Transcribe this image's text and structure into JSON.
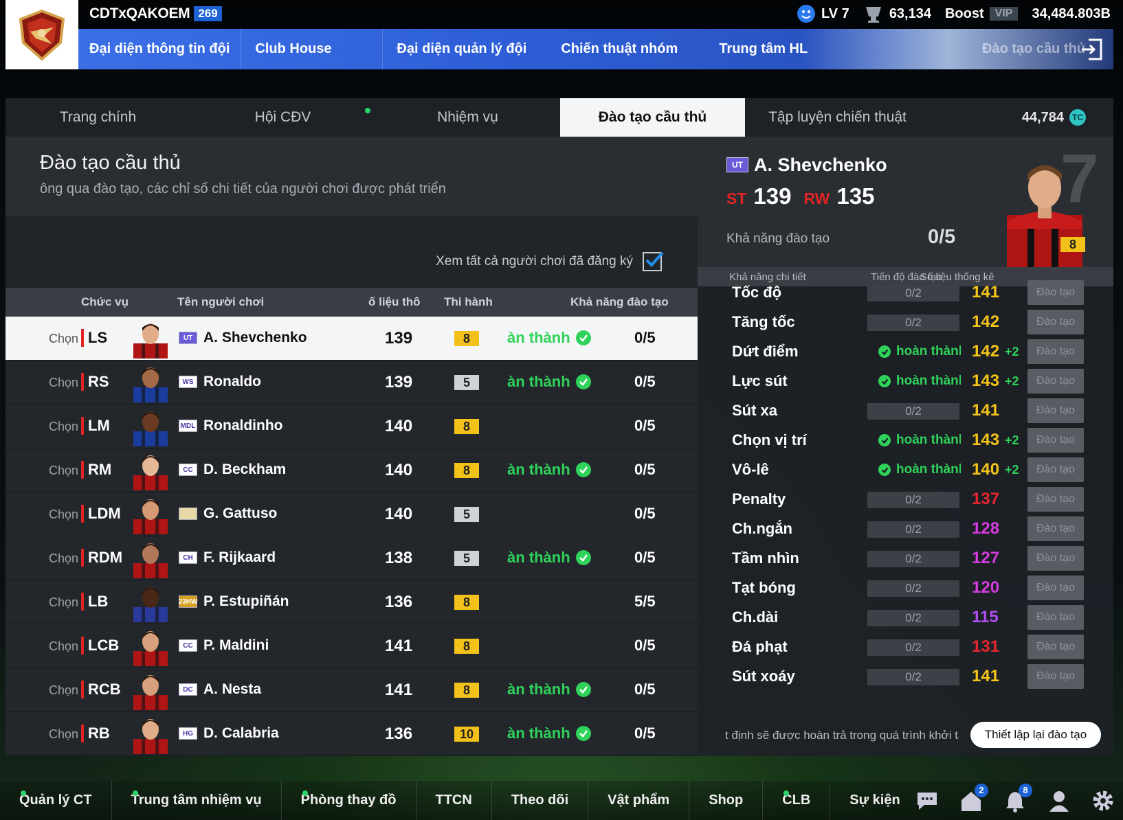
{
  "user": {
    "name": "CDTxQAKOEM",
    "level_badge": "269"
  },
  "stats": {
    "level": "LV 7",
    "points": "63,134",
    "boost": "Boost",
    "vip": "VIP",
    "money": "34,484.803B"
  },
  "nav": {
    "items": [
      "Đại diện thông tin đội",
      "Club House",
      "Đại diện quản lý đội",
      "Chiến thuật nhóm",
      "Trung tâm HL",
      "Đào tạo cầu thủ"
    ]
  },
  "tabs": {
    "items": [
      "Trang chính",
      "Hội CĐV",
      "Nhiệm vụ",
      "Đào tạo cầu thủ",
      "Tập luyện chiến thuật"
    ],
    "coins": "44,784",
    "coin_label": "TC"
  },
  "page": {
    "title": "Đào tạo cầu thủ",
    "subtitle": "ông qua đào tạo, các chỉ số chi tiết của người chơi được phát triển",
    "view_all": "Xem tất cả người chơi đã đăng ký"
  },
  "table": {
    "headers": [
      "Chức vụ",
      "Tên người chơi",
      "ố liệu thô",
      "Thi hành",
      "Khả năng đào tạo"
    ],
    "select_label": "Chọn",
    "done_label": "àn thành",
    "rows": [
      {
        "pos": "LS",
        "card": "UT",
        "name": "A. Shevchenko",
        "ovr": "139",
        "grade": "8",
        "done": true,
        "training": "0/5"
      },
      {
        "pos": "RS",
        "card": "WS",
        "name": "Ronaldo",
        "ovr": "139",
        "grade": "5",
        "done": true,
        "training": "0/5"
      },
      {
        "pos": "LM",
        "card": "MDL",
        "name": "Ronaldinho",
        "ovr": "140",
        "grade": "8",
        "done": false,
        "training": "0/5"
      },
      {
        "pos": "RM",
        "card": "CC",
        "name": "D. Beckham",
        "ovr": "140",
        "grade": "8",
        "done": true,
        "training": "0/5"
      },
      {
        "pos": "LDM",
        "card": "",
        "name": "G. Gattuso",
        "ovr": "140",
        "grade": "5",
        "done": false,
        "training": "0/5"
      },
      {
        "pos": "RDM",
        "card": "CH",
        "name": "F. Rijkaard",
        "ovr": "138",
        "grade": "5",
        "done": true,
        "training": "0/5"
      },
      {
        "pos": "LB",
        "card": "23HW",
        "name": "P. Estupiñán",
        "ovr": "136",
        "grade": "8",
        "done": false,
        "training": "5/5"
      },
      {
        "pos": "LCB",
        "card": "CC",
        "name": "P. Maldini",
        "ovr": "141",
        "grade": "8",
        "done": false,
        "training": "0/5"
      },
      {
        "pos": "RCB",
        "card": "DC",
        "name": "A. Nesta",
        "ovr": "141",
        "grade": "8",
        "done": true,
        "training": "0/5"
      },
      {
        "pos": "RB",
        "card": "HG",
        "name": "D. Calabria",
        "ovr": "136",
        "grade": "10",
        "done": true,
        "training": "0/5"
      }
    ]
  },
  "player": {
    "card": "UT",
    "name": "A. Shevchenko",
    "pos1": "ST",
    "val1": "139",
    "pos2": "RW",
    "val2": "135",
    "training_label": "Khả năng đào tạo",
    "training_value": "0/5",
    "number": "7",
    "grade": "8"
  },
  "attributes": {
    "headers": [
      "Khả năng chi tiết",
      "Tiến độ đào tạo",
      "Số liệu thống kê"
    ],
    "train_button": "Đào tạo",
    "done_text": "hoàn thành",
    "items": [
      {
        "name": "Tốc độ",
        "progress": "0/2",
        "done": false,
        "value": "141",
        "plus": "",
        "color": "#f5c518"
      },
      {
        "name": "Tăng tốc",
        "progress": "0/2",
        "done": false,
        "value": "142",
        "plus": "",
        "color": "#f5c518"
      },
      {
        "name": "Dứt điểm",
        "progress": "",
        "done": true,
        "value": "142",
        "plus": "+2",
        "color": "#f5c518"
      },
      {
        "name": "Lực sút",
        "progress": "",
        "done": true,
        "value": "143",
        "plus": "+2",
        "color": "#f5c518"
      },
      {
        "name": "Sút xa",
        "progress": "0/2",
        "done": false,
        "value": "141",
        "plus": "",
        "color": "#f5c518"
      },
      {
        "name": "Chọn vị trí",
        "progress": "",
        "done": true,
        "value": "143",
        "plus": "+2",
        "color": "#f5c518"
      },
      {
        "name": "Vô-lê",
        "progress": "",
        "done": true,
        "value": "140",
        "plus": "+2",
        "color": "#f5c518"
      },
      {
        "name": "Penalty",
        "progress": "0/2",
        "done": false,
        "value": "137",
        "plus": "",
        "color": "#e8262f"
      },
      {
        "name": "Ch.ngắn",
        "progress": "0/2",
        "done": false,
        "value": "128",
        "plus": "",
        "color": "#d63be0"
      },
      {
        "name": "Tầm nhìn",
        "progress": "0/2",
        "done": false,
        "value": "127",
        "plus": "",
        "color": "#d63be0"
      },
      {
        "name": "Tạt bóng",
        "progress": "0/2",
        "done": false,
        "value": "120",
        "plus": "",
        "color": "#d63be0"
      },
      {
        "name": "Ch.dài",
        "progress": "0/2",
        "done": false,
        "value": "115",
        "plus": "",
        "color": "#b04ef0"
      },
      {
        "name": "Đá phạt",
        "progress": "0/2",
        "done": false,
        "value": "131",
        "plus": "",
        "color": "#e8262f"
      },
      {
        "name": "Sút xoáy",
        "progress": "0/2",
        "done": false,
        "value": "141",
        "plus": "",
        "color": "#f5c518"
      }
    ],
    "footnote": "t định sẽ được hoàn trả trong quá trình khởi tạo",
    "reset_button": "Thiết lập lại đào tạo"
  },
  "bottom": {
    "items": [
      "Quản lý CT",
      "Trung tâm nhiệm vụ",
      "Phòng thay đồ",
      "TTCN",
      "Theo dõi",
      "Vật phẩm",
      "Shop",
      "CLB",
      "Sự kiện"
    ],
    "home_badge": "2",
    "bell_badge": "8"
  },
  "colors": {
    "accent_blue": "#2e5fd8",
    "gold": "#f2c21a",
    "green": "#2fd35a",
    "red": "#e02424"
  }
}
